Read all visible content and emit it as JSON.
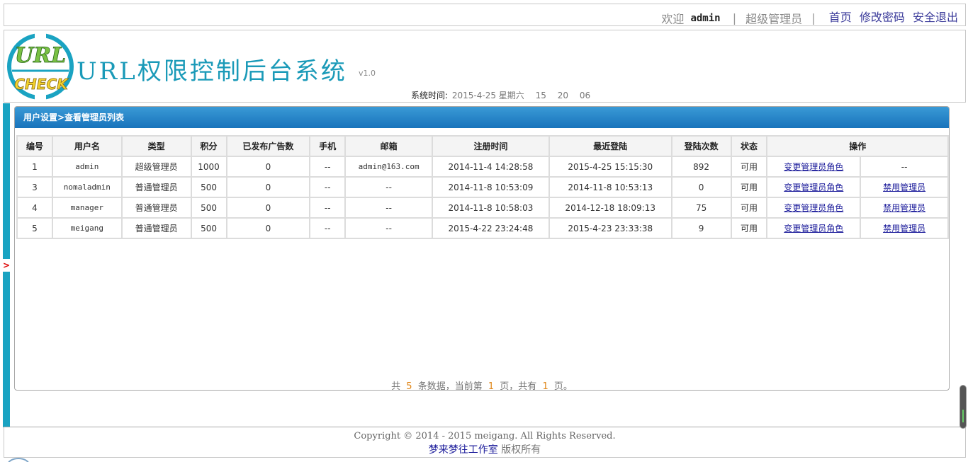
{
  "topbar": {
    "welcome": "欢迎",
    "user": "admin",
    "role": "超级管理员",
    "home": "首页",
    "change_password": "修改密码",
    "logout": "安全退出"
  },
  "header": {
    "logo_text_1": "URL",
    "logo_text_2": "CHECK",
    "title": "URL权限控制后台系统",
    "version": "v1.0",
    "time_label": "系统时间:",
    "date": "2015-4-25 星期六",
    "hour": "15",
    "minute": "20",
    "second": "06"
  },
  "sidebar": {
    "toggle": ">"
  },
  "panel": {
    "breadcrumb": "用户设置>查看管理员列表",
    "columns": [
      "编号",
      "用户名",
      "类型",
      "积分",
      "已发布广告数",
      "手机",
      "邮箱",
      "注册时间",
      "最近登陆",
      "登陆次数",
      "状态",
      "操作"
    ],
    "rows": [
      {
        "id": "1",
        "username": "admin",
        "type": "超级管理员",
        "points": "1000",
        "ads": "0",
        "phone": "--",
        "email": "admin@163.com",
        "registered": "2014-11-4 14:28:58",
        "last_login": "2015-4-25 15:15:30",
        "logins": "892",
        "status": "可用",
        "action1": "变更管理员角色",
        "action2": "--"
      },
      {
        "id": "3",
        "username": "nomaladmin",
        "type": "普通管理员",
        "points": "500",
        "ads": "0",
        "phone": "--",
        "email": "--",
        "registered": "2014-11-8 10:53:09",
        "last_login": "2014-11-8 10:53:13",
        "logins": "0",
        "status": "可用",
        "action1": "变更管理员角色",
        "action2": "禁用管理员"
      },
      {
        "id": "4",
        "username": "manager",
        "type": "普通管理员",
        "points": "500",
        "ads": "0",
        "phone": "--",
        "email": "--",
        "registered": "2014-11-8 10:58:03",
        "last_login": "2014-12-18 18:09:13",
        "logins": "75",
        "status": "可用",
        "action1": "变更管理员角色",
        "action2": "禁用管理员"
      },
      {
        "id": "5",
        "username": "meigang",
        "type": "普通管理员",
        "points": "500",
        "ads": "0",
        "phone": "--",
        "email": "--",
        "registered": "2015-4-22 23:24:48",
        "last_login": "2015-4-23 23:33:38",
        "logins": "9",
        "status": "可用",
        "action1": "变更管理员角色",
        "action2": "禁用管理员"
      }
    ],
    "pager": {
      "prefix": "共",
      "total": "5",
      "mid1": "条数据，当前第",
      "current": "1",
      "mid2": "页，共有",
      "pages": "1",
      "suffix": "页。"
    }
  },
  "footer": {
    "copyright": "Copyright © 2014 - 2015 meigang. All Rights Reserved.",
    "studio": "梦来梦往工作室",
    "rights": "版权所有"
  },
  "colors": {
    "accent": "#1aa3c2",
    "panel_header": "#1873bb",
    "link": "#1a1a9a",
    "highlight_number": "#e0871a"
  }
}
